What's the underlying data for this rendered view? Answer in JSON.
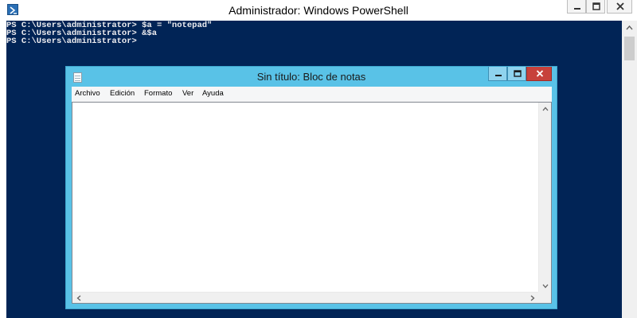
{
  "powershell": {
    "title": "Administrador: Windows PowerShell",
    "app_icon": "powershell-icon",
    "buttons": {
      "minimize": "minimize-icon",
      "maximize": "maximize-icon",
      "close": "close-icon"
    },
    "console": {
      "background_color": "#012456",
      "text_color": "#eeedf0",
      "lines": [
        "PS C:\\Users\\administrator> $a = \"notepad\"",
        "PS C:\\Users\\administrator> &$a",
        "PS C:\\Users\\administrator>"
      ]
    }
  },
  "notepad": {
    "title": "Sin título: Bloc de notas",
    "app_icon": "notepad-icon",
    "accent_color": "#59c2e7",
    "close_color": "#c7413b",
    "menu": [
      "Archivo",
      "Edición",
      "Formato",
      "Ver",
      "Ayuda"
    ],
    "content": ""
  }
}
